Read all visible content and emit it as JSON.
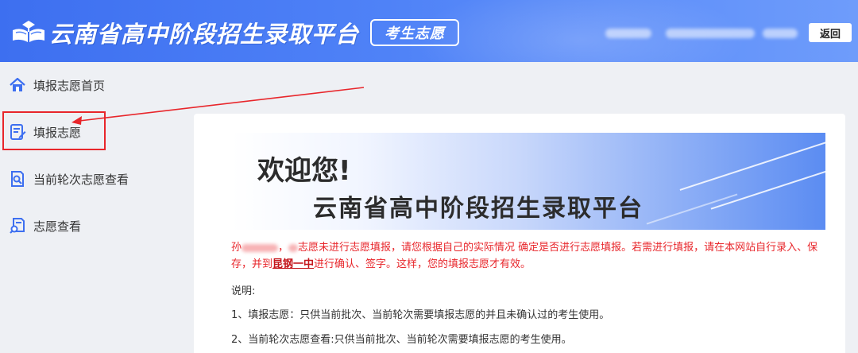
{
  "header": {
    "title": "云南省高中阶段招生录取平台",
    "badge": "考生志愿",
    "back_label": "返回"
  },
  "sidebar": {
    "items": [
      {
        "label": "填报志愿首页",
        "icon": "home-icon"
      },
      {
        "label": "填报志愿",
        "icon": "edit-form-icon"
      },
      {
        "label": "当前轮次志愿查看",
        "icon": "search-document-icon"
      },
      {
        "label": "志愿查看",
        "icon": "view-document-icon"
      }
    ]
  },
  "annotation": {
    "highlight_color": "#e8262b"
  },
  "banner": {
    "welcome": "欢迎您!",
    "title": "云南省高中阶段招生录取平台"
  },
  "notice": {
    "part1": "孙",
    "part2": "志愿未进行志愿填报，请您根据自己的实际情况 确定是否进行志愿填报。若需进行填报，请在本网站自行录入、保存，并到",
    "school": "昆钢一中",
    "part3": "进行确认、签字。这样，您的填报志愿才有效。"
  },
  "description": {
    "heading": "说明:",
    "lines": [
      "1、填报志愿：只供当前批次、当前轮次需要填报志愿的并且未确认过的考生使用。",
      "2、当前轮次志愿查看:只供当前批次、当前轮次需要填报志愿的考生使用。"
    ]
  },
  "colors": {
    "header_blue": "#3d6ff0",
    "notice_red": "#e8262b",
    "sidebar_bg": "#eef0f4"
  }
}
